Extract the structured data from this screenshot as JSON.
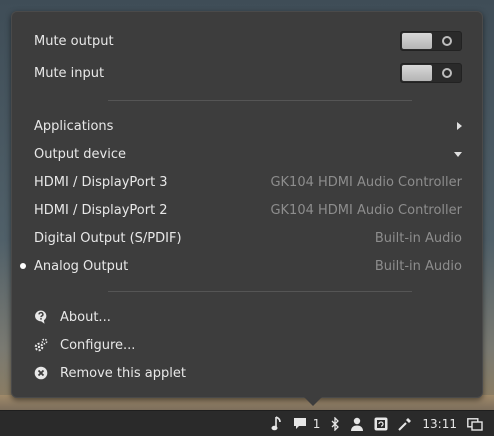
{
  "toggles": {
    "mute_output": "Mute output",
    "mute_input": "Mute input"
  },
  "menu": {
    "applications": "Applications",
    "output_device": "Output device"
  },
  "devices": [
    {
      "name": "HDMI / DisplayPort 3",
      "desc": "GK104 HDMI Audio Controller"
    },
    {
      "name": "HDMI / DisplayPort 2",
      "desc": "GK104 HDMI Audio Controller"
    },
    {
      "name": "Digital Output (S/PDIF)",
      "desc": "Built-in Audio"
    },
    {
      "name": "Analog Output",
      "desc": "Built-in Audio",
      "active": true
    }
  ],
  "actions": {
    "about": "About...",
    "configure": "Configure...",
    "remove": "Remove this applet"
  },
  "panel": {
    "notification_count": "1",
    "time": "13:11"
  },
  "icons": [
    "music-note-icon",
    "chat-icon",
    "bluetooth-icon",
    "user-icon",
    "update-icon",
    "color-picker-icon",
    "window-list-icon",
    "help-icon",
    "gear-icon",
    "close-circle-icon"
  ]
}
